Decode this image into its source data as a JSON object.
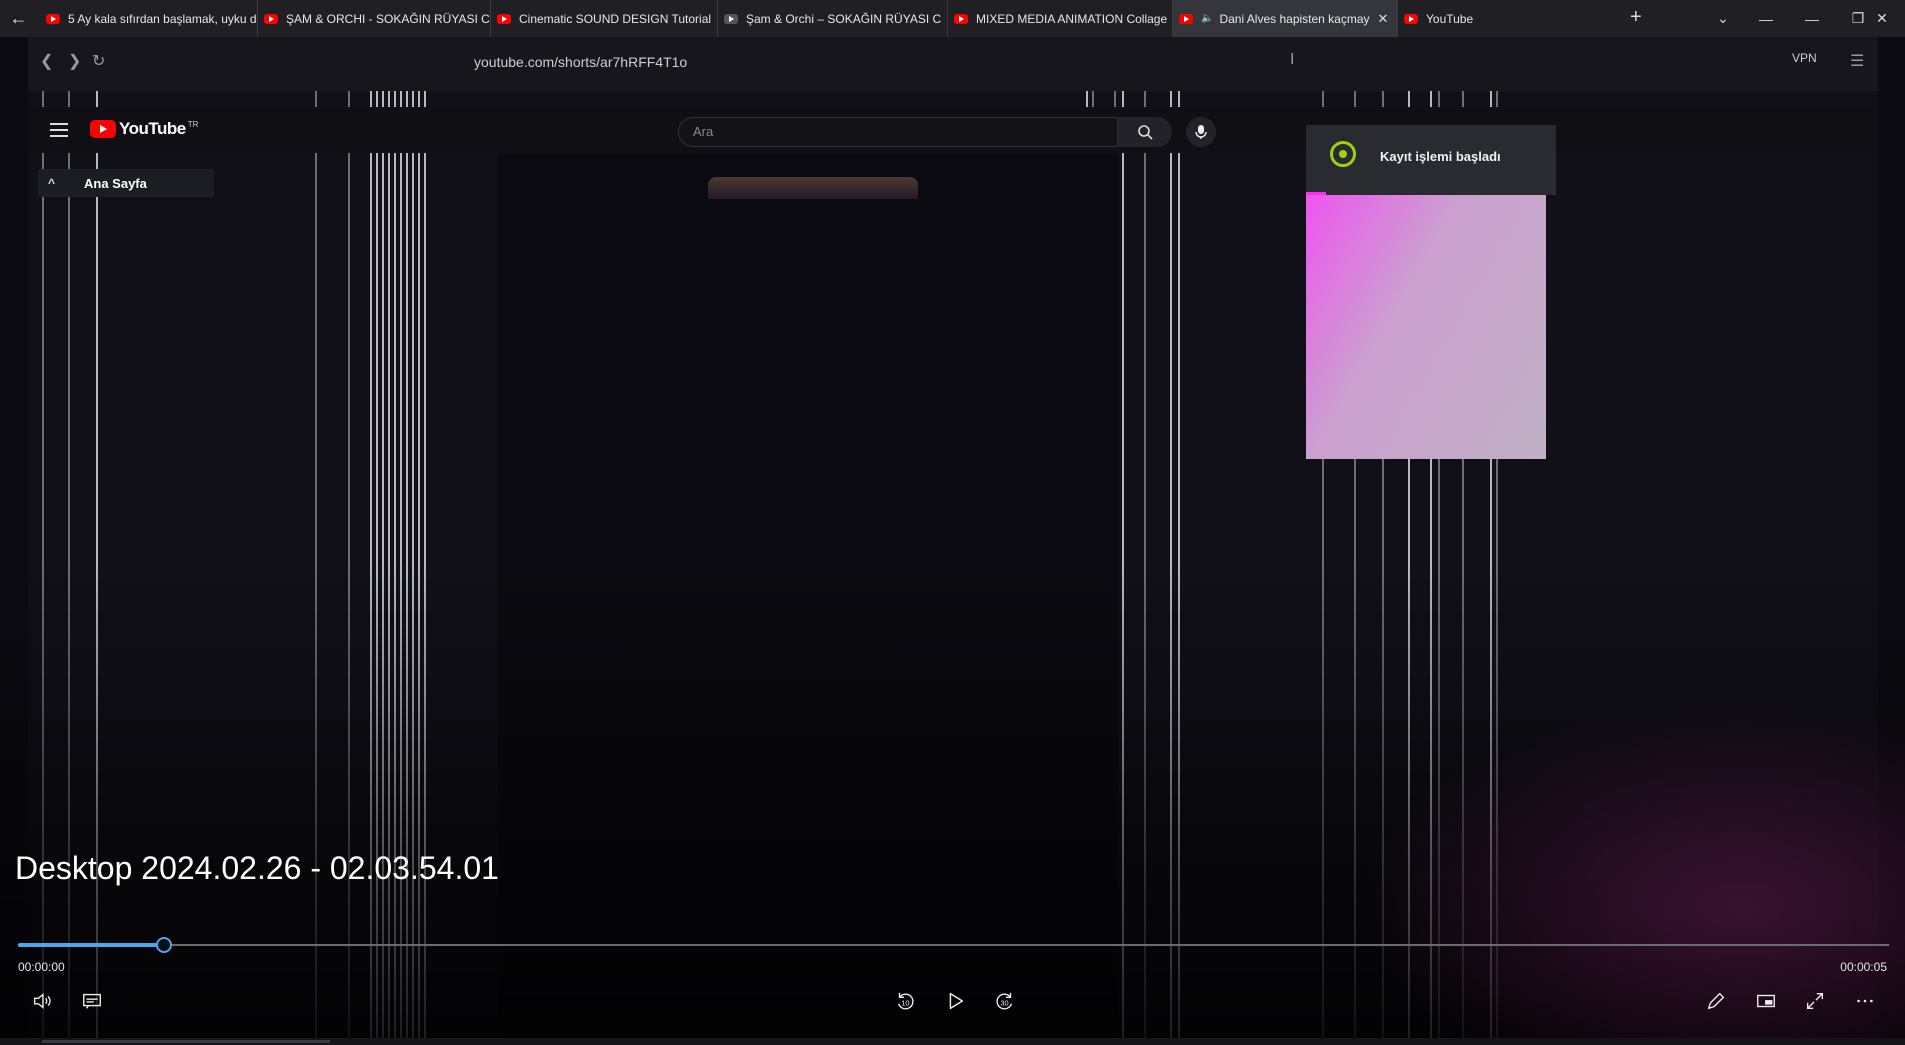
{
  "tabs": [
    {
      "title": "5 Ay kala sıfırdan başlamak, uyku dü",
      "favicon": "youtube-icon",
      "active": false
    },
    {
      "title": "ŞAM & ORCHI - SOKAĞIN RÜYASI C",
      "favicon": "youtube-icon",
      "active": false
    },
    {
      "title": "Cinematic SOUND DESIGN Tutorial",
      "favicon": "youtube-icon",
      "active": false
    },
    {
      "title": "Şam & Orchi – SOKAĞIN RÜYASI C",
      "favicon": "generic-icon",
      "active": false
    },
    {
      "title": "MIXED MEDIA ANIMATION Collage",
      "favicon": "youtube-icon",
      "active": false
    },
    {
      "title": "Dani Alves hapisten kaçmay",
      "favicon": "youtube-icon",
      "active": true
    },
    {
      "title": "YouTube",
      "favicon": "youtube-icon",
      "active": false
    }
  ],
  "browser": {
    "url": "youtube.com/shorts/ar7hRFF4T1o",
    "vpn_label": "VPN"
  },
  "youtube": {
    "logo_text": "YouTube",
    "country_code": "TR",
    "search_placeholder": "Ara",
    "sidebar_home": "Ana Sayfa"
  },
  "recording": {
    "notification": "Kayıt işlemi başladı",
    "accent_color": "#9bd40f"
  },
  "player": {
    "file_title": "Desktop 2024.02.26 - 02.03.54.01",
    "current_time": "00:00:00",
    "total_time": "00:00:05",
    "progress_fraction": 0.078,
    "accent_color": "#4aa8f0",
    "controls": {
      "volume": "volume-icon",
      "captions": "captions-icon",
      "rewind": "rewind-10-icon",
      "play": "play-icon",
      "forward": "forward-30-icon",
      "edit": "pen-icon",
      "miniplayer": "miniplayer-icon",
      "fullscreen": "fullscreen-icon",
      "more": "more-icon"
    },
    "skip_back_seconds": "10",
    "skip_forward_seconds": "30"
  }
}
